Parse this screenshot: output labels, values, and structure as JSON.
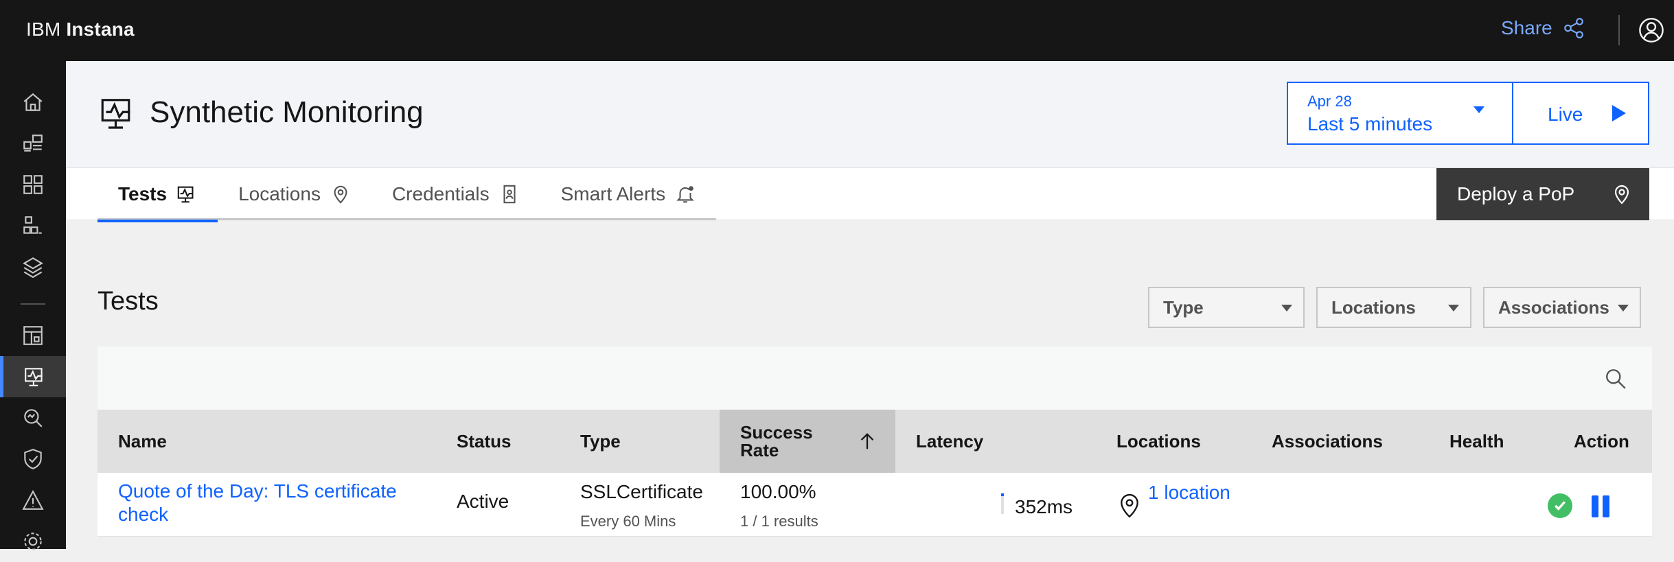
{
  "topbar": {
    "brand_prefix": "IBM",
    "brand_name": "Instana",
    "share_label": "Share"
  },
  "leftnav": {
    "items": [
      "home-icon",
      "applications-icon",
      "platform-icon",
      "infrastructure-icon",
      "layers-icon",
      "dashboard-icon",
      "synthetic-monitoring-icon",
      "analytics-icon",
      "security-icon",
      "alert-icon",
      "settings-icon"
    ],
    "active": "synthetic-monitoring-icon"
  },
  "header": {
    "title": "Synthetic Monitoring",
    "date_label": "Apr 28",
    "range_label": "Last 5 minutes",
    "live_label": "Live"
  },
  "tabs": [
    {
      "label": "Tests",
      "icon": "monitor-icon"
    },
    {
      "label": "Locations",
      "icon": "location-pin-icon"
    },
    {
      "label": "Credentials",
      "icon": "credential-badge-icon"
    },
    {
      "label": "Smart Alerts",
      "icon": "bell-icon"
    }
  ],
  "deploy_label": "Deploy a PoP",
  "section_title": "Tests",
  "filters": [
    "Type",
    "Locations",
    "Associations"
  ],
  "table": {
    "columns": [
      "Name",
      "Status",
      "Type",
      "Success Rate",
      "Latency",
      "Locations",
      "Associations",
      "Health",
      "Action"
    ],
    "sorted_column": "Success Rate",
    "sort_direction": "ascending",
    "rows": [
      {
        "name": "Quote of the Day: TLS certificate check",
        "status": "Active",
        "type": "SSLCertificate",
        "frequency": "Every 60 Mins",
        "success_rate": "100.00%",
        "results": "1 / 1 results",
        "latency": "352ms",
        "locations": "1 location",
        "associations": "",
        "health": "healthy",
        "action": "pause"
      }
    ]
  },
  "colors": {
    "accent": "#0f62fe",
    "link": "#0f62fe",
    "health_ok": "#42be65",
    "topbar": "#161616",
    "share": "#78a9ff"
  }
}
